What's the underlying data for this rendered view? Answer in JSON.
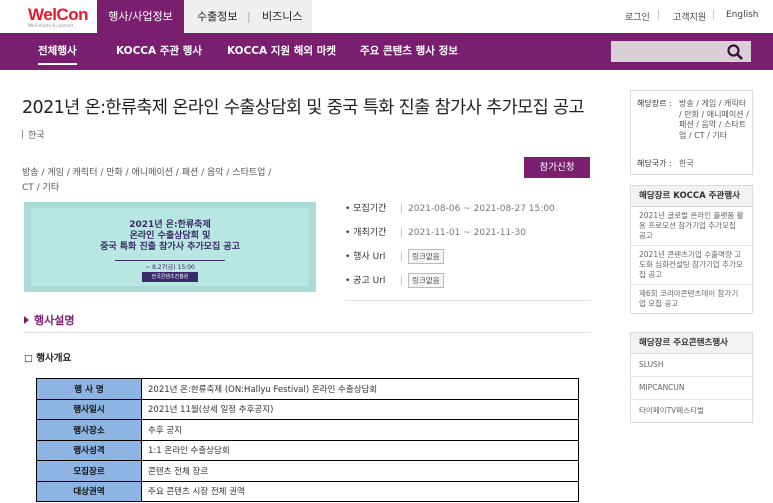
{
  "brand": {
    "logo_text": "WelCon",
    "logo_tagline": "Well-made K-content"
  },
  "top_tabs": {
    "active": "행사/사업정보",
    "export": "수출정보",
    "divider": "|",
    "business": "비즈니스"
  },
  "utility": {
    "login": "로그인",
    "support": "고객지원",
    "english": "English",
    "sep": "|"
  },
  "nav": {
    "items": [
      "전체행사",
      "KOCCA 주관 행사",
      "KOCCA 지원 해외 마켓",
      "주요 콘텐츠 행사 정보"
    ],
    "search_placeholder": ""
  },
  "event": {
    "title": "2021년 온:한류축제 온라인 수출상담회 및 중국 특화 진출 참가사 추가모집 공고",
    "country": "한국",
    "genres": "방송 / 게임 / 캐릭터 / 만화 / 애니메이션 / 패션 / 음악 / 스타트업 / CT / 기타",
    "apply_label": "참가신청",
    "banner": {
      "line1": "2021년 온:한류축제",
      "line2": "온라인 수출상담회 및",
      "line3": "중국 특화 진출 참가사 추가모집 공고",
      "date": "~ 8.27(금) 15:00",
      "org": "한국콘텐츠진흥원"
    },
    "info": [
      {
        "label": "모집기간",
        "value": "2021-08-06 ~ 2021-08-27 15:00"
      },
      {
        "label": "개최기간",
        "value": "2021-11-01 ~ 2021-11-30"
      },
      {
        "label": "행사 Url",
        "value": "링크없음"
      },
      {
        "label": "공고 Url",
        "value": "링크없음"
      }
    ],
    "info_sep": "|",
    "section_title": "행사설명",
    "subsection_title": "□ 행사개요",
    "table": [
      {
        "k": "행 사 명",
        "v": "2021년 온:한류축제 (ON:Hallyu Festival) 온라인 수출상담회"
      },
      {
        "k": "행사일시",
        "v": "2021년 11월(상세 일정 추후공지)"
      },
      {
        "k": "행사장소",
        "v": "추후 공지"
      },
      {
        "k": "행사성격",
        "v": "1:1 온라인 수출상담회"
      },
      {
        "k": "모집장르",
        "v": "콘텐츠 전체 장르"
      },
      {
        "k": "대상권역",
        "v": "주요 콘텐츠 시장 전체 권역"
      }
    ]
  },
  "sidebar": {
    "genre_label": "해당장르 :",
    "genre_value": "방송 / 게임 / 캐릭터 / 만화 / 애니메이션 / 패션 / 음악 / 스타트업 / CT / 기타",
    "country_label": "해당국가 :",
    "country_value": "한국",
    "kocca_head": "해당장르 KOCCA 주관행사",
    "kocca_items": [
      "2021년 글로벌 온라인 플랫폼 활용 프로모션 참가기업 추가모집 공고",
      "2021년 콘텐츠기업 수출역량 고도화 심화컨설팅 참가기업 추가모집 공고",
      "제6회 코리아콘텐츠데이 참가기업 모집 공고"
    ],
    "main_head": "해당장르 주요콘텐츠행사",
    "main_items": [
      "SLUSH",
      "MIPCANCUN",
      "타이페이TV페스티벌"
    ]
  }
}
